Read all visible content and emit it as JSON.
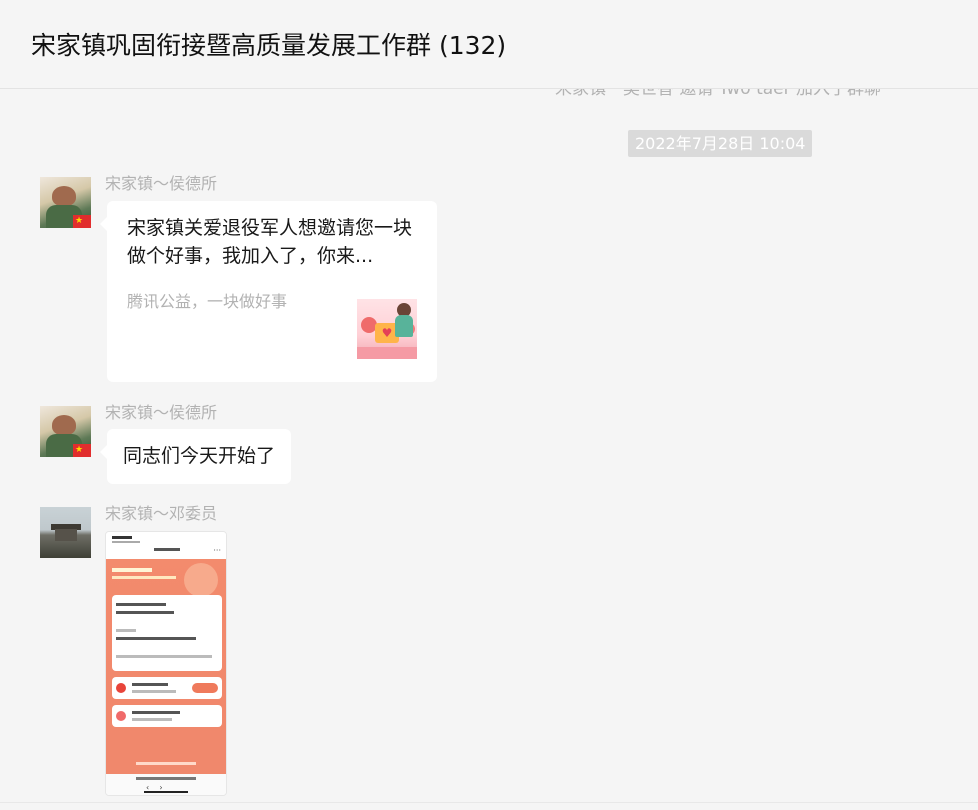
{
  "header": {
    "title": "宋家镇巩固衔接暨高质量发展工作群 (132)"
  },
  "system_message_partial": "宋家镇一吴世香 邀请 Two  taer 加入了群聊",
  "timestamp": "2022年7月28日 10:04",
  "messages": [
    {
      "sender": "宋家镇～侯德所",
      "type": "link-card",
      "card_title": "宋家镇关爱退役军人想邀请您一块做个好事，我加入了，你来...",
      "card_source": "腾讯公益，一块做好事"
    },
    {
      "sender": "宋家镇～侯德所",
      "type": "text",
      "text": "同志们今天开始了"
    },
    {
      "sender": "宋家镇～邓委员",
      "type": "image"
    }
  ],
  "icons": {
    "avatar_flag": "china-flag-icon",
    "card_thumbnail": "charity-illustration-icon"
  },
  "colors": {
    "background": "#f5f5f5",
    "bubble": "#ffffff",
    "timestamp_bg": "#dadada",
    "nickname": "#b2b2b2"
  }
}
